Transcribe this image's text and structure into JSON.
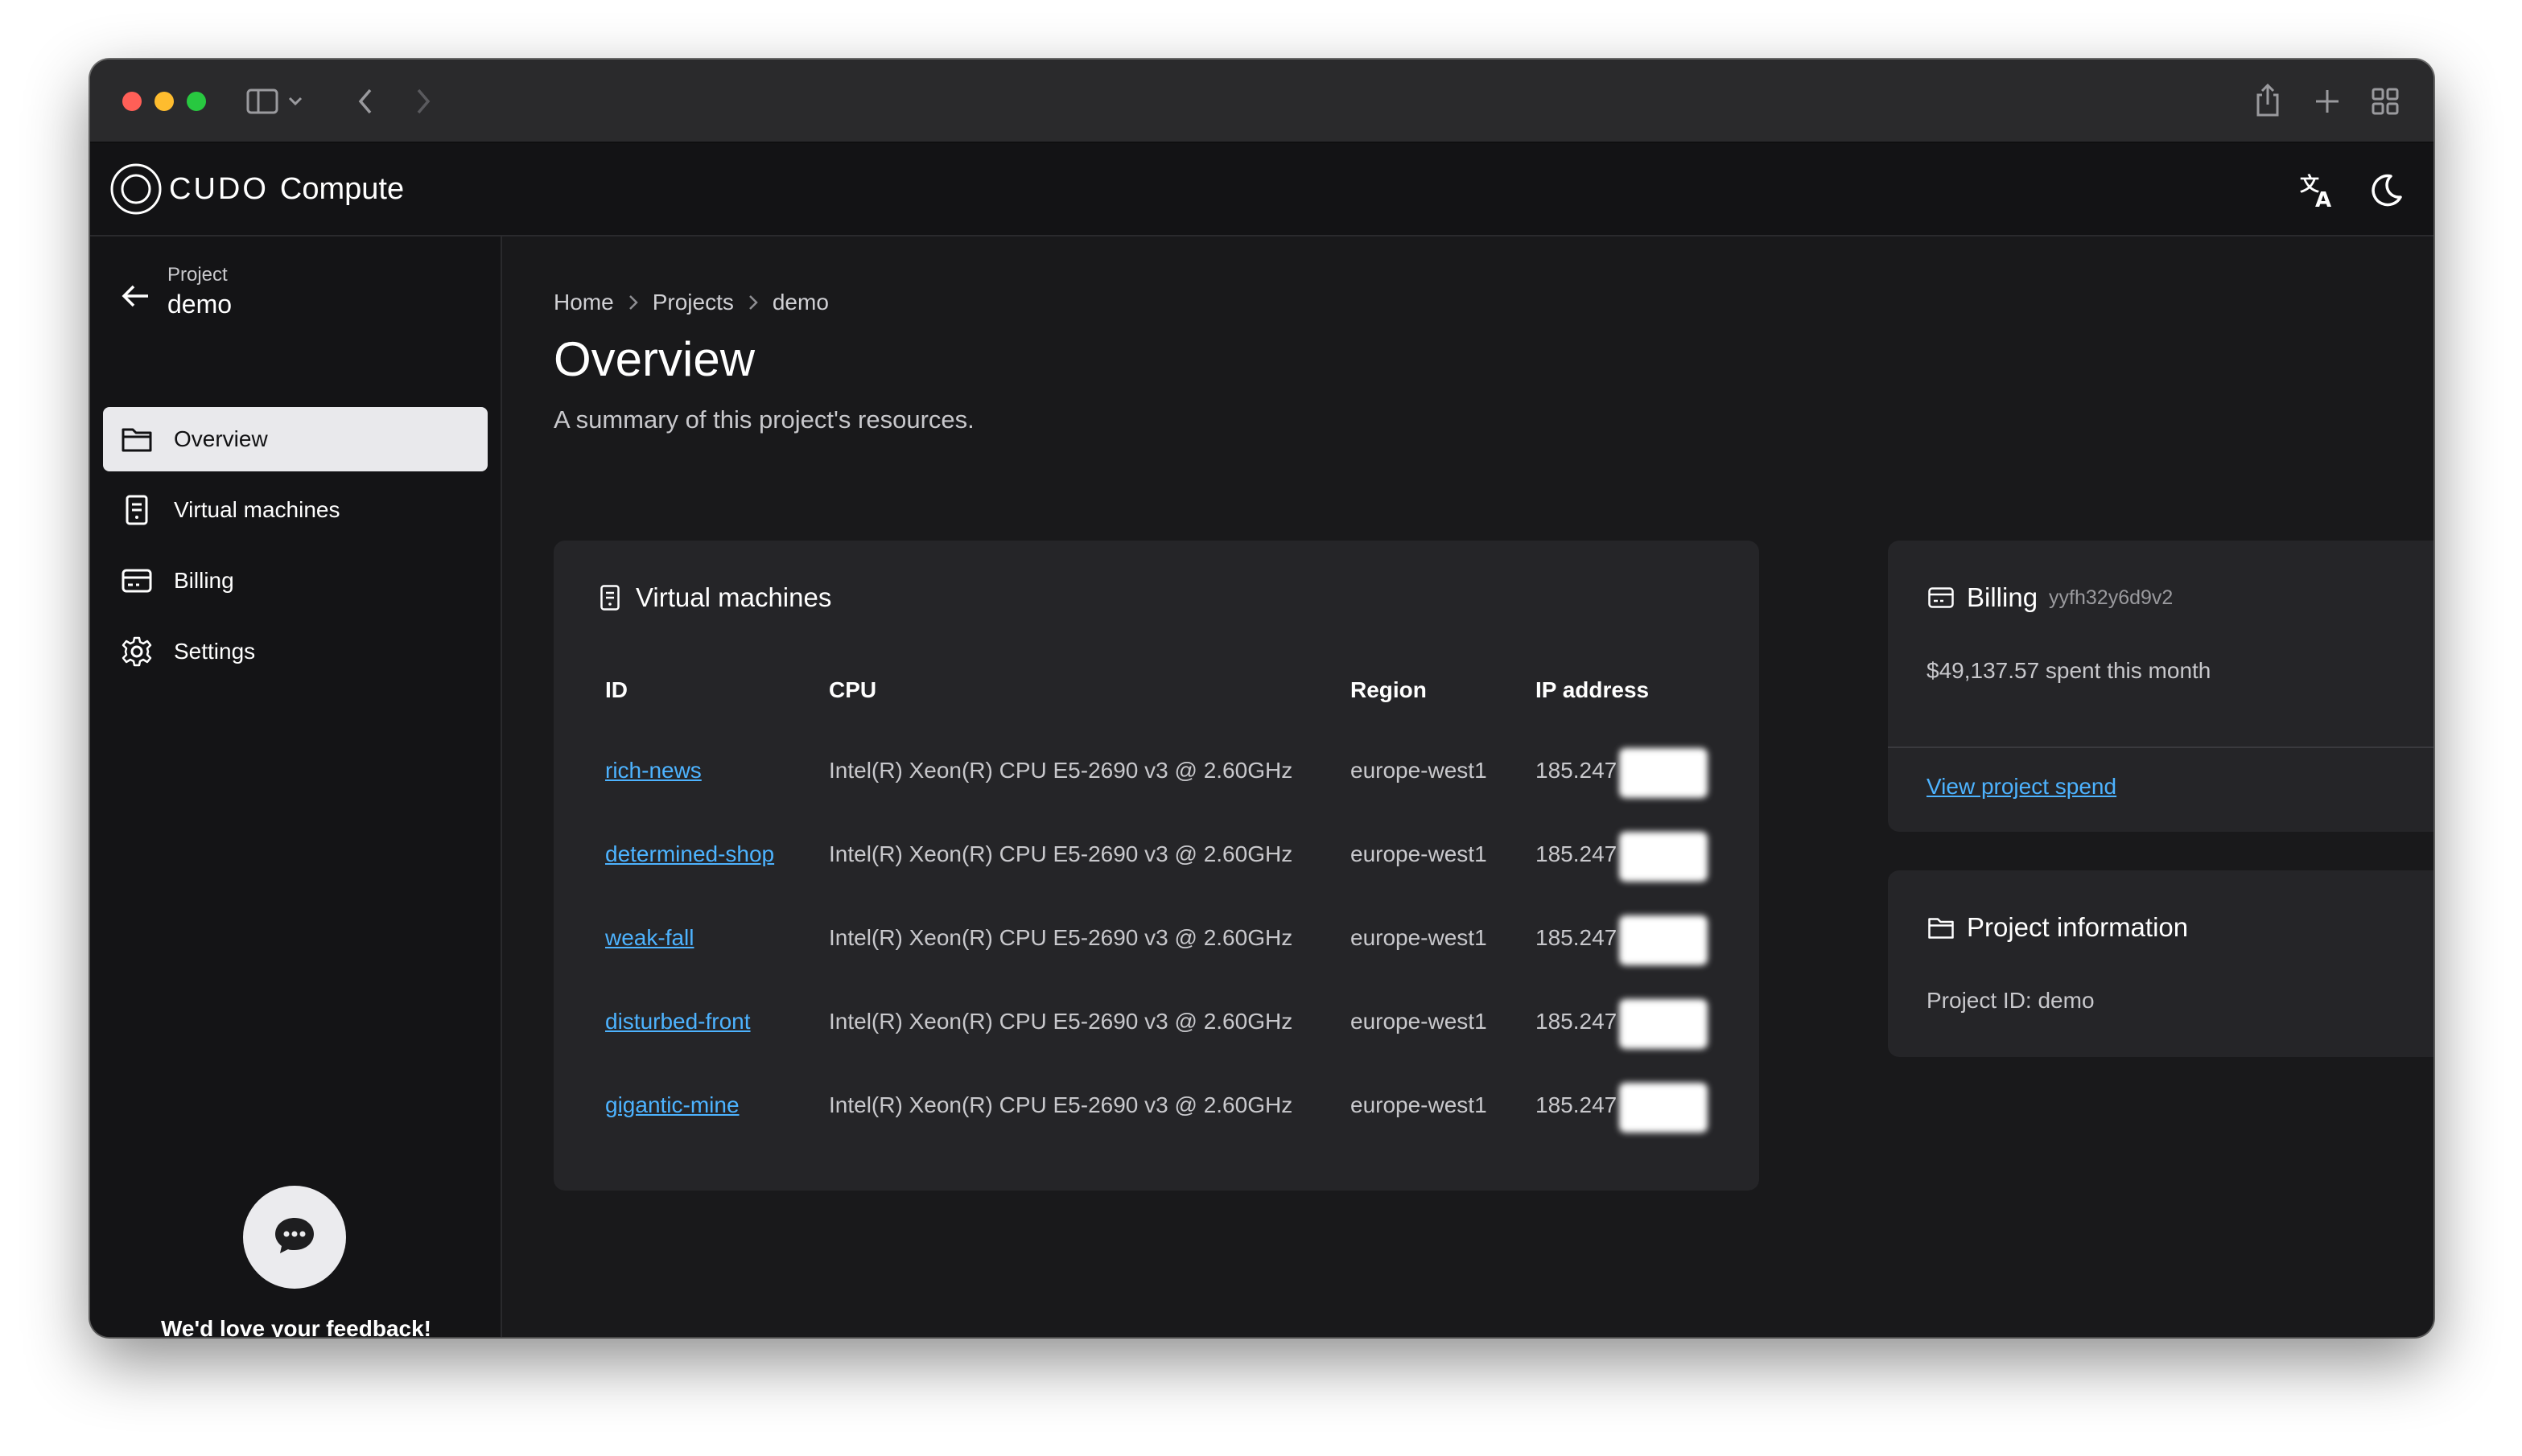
{
  "header": {
    "brand_name": "CUDO",
    "brand_product": "Compute",
    "icons": [
      "translate-icon",
      "moon-icon",
      "user-icon"
    ]
  },
  "sidebar": {
    "project_label": "Project",
    "project_name": "demo",
    "items": [
      {
        "label": "Overview",
        "icon": "folder-icon",
        "active": true
      },
      {
        "label": "Virtual machines",
        "icon": "document-icon",
        "active": false
      },
      {
        "label": "Billing",
        "icon": "credit-card-icon",
        "active": false
      },
      {
        "label": "Settings",
        "icon": "gear-icon",
        "active": false
      }
    ],
    "feedback_text": "We'd love your feedback!"
  },
  "breadcrumb": [
    "Home",
    "Projects",
    "demo"
  ],
  "page": {
    "title": "Overview",
    "subtitle": "A summary of this project's resources."
  },
  "vm_card": {
    "title": "Virtual machines",
    "columns": [
      "ID",
      "CPU",
      "Region",
      "IP address"
    ],
    "rows": [
      {
        "id": "rich-news",
        "cpu": "Intel(R) Xeon(R) CPU E5-2690 v3 @ 2.60GHz",
        "region": "europe-west1",
        "ip": "185.247"
      },
      {
        "id": "determined-shop",
        "cpu": "Intel(R) Xeon(R) CPU E5-2690 v3 @ 2.60GHz",
        "region": "europe-west1",
        "ip": "185.247"
      },
      {
        "id": "weak-fall",
        "cpu": "Intel(R) Xeon(R) CPU E5-2690 v3 @ 2.60GHz",
        "region": "europe-west1",
        "ip": "185.247"
      },
      {
        "id": "disturbed-front",
        "cpu": "Intel(R) Xeon(R) CPU E5-2690 v3 @ 2.60GHz",
        "region": "europe-west1",
        "ip": "185.247"
      },
      {
        "id": "gigantic-mine",
        "cpu": "Intel(R) Xeon(R) CPU E5-2690 v3 @ 2.60GHz",
        "region": "europe-west1",
        "ip": "185.247"
      }
    ]
  },
  "billing_card": {
    "title": "Billing",
    "account_id": "yyfh32y6d9v2",
    "spend_text": "$49,137.57 spent this month",
    "link_label": "View project spend"
  },
  "info_card": {
    "title": "Project information",
    "project_id_text": "Project ID: demo"
  },
  "colors": {
    "background": "#19191b",
    "card": "#252528",
    "link": "#4db3ff",
    "active_nav": "#e9e9ec"
  }
}
